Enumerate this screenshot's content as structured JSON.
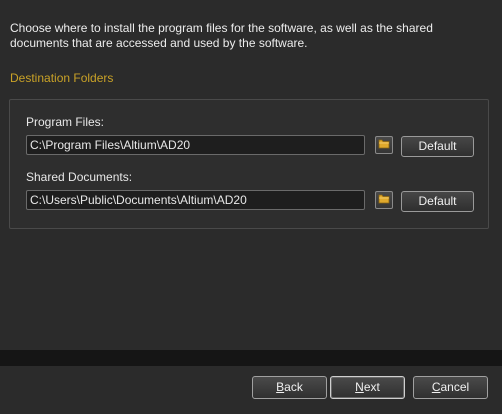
{
  "intro_text": "Choose where to install the program files for the software, as well as the shared documents that are accessed and used by the software.",
  "section_title": "Destination Folders",
  "program_files": {
    "label": "Program Files:",
    "value": "C:\\Program Files\\Altium\\AD20",
    "default_label": "Default"
  },
  "shared_documents": {
    "label": "Shared Documents:",
    "value": "C:\\Users\\Public\\Documents\\Altium\\AD20",
    "default_label": "Default"
  },
  "footer": {
    "back": {
      "accel": "B",
      "rest": "ack"
    },
    "next": {
      "accel": "N",
      "rest": "ext"
    },
    "cancel": {
      "accel": "C",
      "rest": "ancel"
    }
  },
  "colors": {
    "accent": "#c9a227",
    "background": "#2b2b2b",
    "band": "#151515"
  },
  "icons": {
    "browse": "folder-browse-icon"
  }
}
